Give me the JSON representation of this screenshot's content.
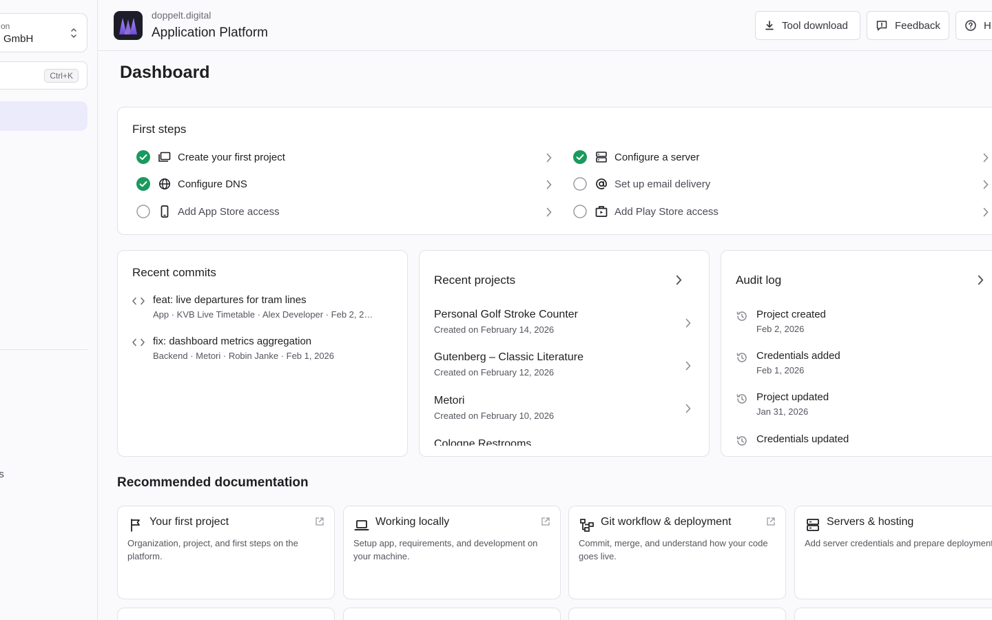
{
  "sidebar": {
    "org_label_partial": "on",
    "org_name_partial": "GmbH",
    "search_shortcut": "Ctrl+K",
    "settings_label_partial": "ttings"
  },
  "header": {
    "brand_sub": "doppelt.digital",
    "brand_title": "Application Platform",
    "buttons": {
      "tool_download": "Tool download",
      "feedback": "Feedback",
      "help_partial": "H"
    }
  },
  "page": {
    "title": "Dashboard"
  },
  "first_steps": {
    "title": "First steps",
    "items": [
      {
        "label": "Create your first project",
        "done": true,
        "icon": "folders-icon"
      },
      {
        "label": "Configure a server",
        "done": true,
        "icon": "server-icon"
      },
      {
        "label": "Configure DNS",
        "done": true,
        "icon": "globe-icon"
      },
      {
        "label": "Set up email delivery",
        "done": false,
        "icon": "at-sign-icon"
      },
      {
        "label": "Add App Store access",
        "done": false,
        "icon": "phone-icon"
      },
      {
        "label": "Add Play Store access",
        "done": false,
        "icon": "store-bag-icon"
      }
    ]
  },
  "recent_commits": {
    "title": "Recent commits",
    "items": [
      {
        "title": "feat: live departures for tram lines",
        "meta": "App · KVB Live Timetable · Alex Developer · Feb 2, 2…"
      },
      {
        "title": "fix: dashboard metrics aggregation",
        "meta": "Backend · Metori · Robin Janke · Feb 1, 2026"
      }
    ]
  },
  "recent_projects": {
    "title": "Recent projects",
    "items": [
      {
        "name": "Personal Golf Stroke Counter",
        "date": "Created on February 14, 2026"
      },
      {
        "name": "Gutenberg – Classic Literature",
        "date": "Created on February 12, 2026"
      },
      {
        "name": "Metori",
        "date": "Created on February 10, 2026"
      },
      {
        "name": "Cologne Restrooms",
        "date": ""
      }
    ]
  },
  "audit_log": {
    "title": "Audit log",
    "items": [
      {
        "title": "Project created",
        "date": "Feb 2, 2026"
      },
      {
        "title": "Credentials added",
        "date": "Feb 1, 2026"
      },
      {
        "title": "Project updated",
        "date": "Jan 31, 2026"
      },
      {
        "title": "Credentials updated",
        "date": ""
      }
    ]
  },
  "recommended": {
    "title": "Recommended documentation",
    "items": [
      {
        "title": "Your first project",
        "desc": "Organization, project, and first steps on the platform.",
        "icon": "flag-icon"
      },
      {
        "title": "Working locally",
        "desc": "Setup app, requirements, and development on your machine.",
        "icon": "laptop-icon"
      },
      {
        "title": "Git workflow & deployment",
        "desc": "Commit, merge, and understand how your code goes live.",
        "icon": "git-flow-icon"
      },
      {
        "title": "Servers & hosting",
        "desc": "Add server credentials and prepare deployments.",
        "icon": "server-icon"
      }
    ]
  },
  "colors": {
    "accent": "#7c5ce0",
    "success": "#1a9a5e",
    "active_nav_bg": "#ebebfb"
  }
}
